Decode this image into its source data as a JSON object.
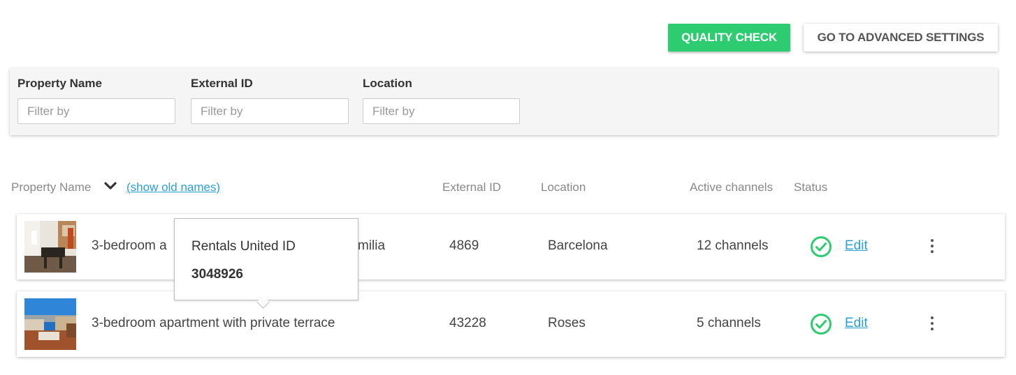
{
  "toolbar": {
    "quality_check_label": "QUALITY CHECK",
    "advanced_settings_label": "GO TO ADVANCED SETTINGS",
    "accent_color": "#2ecc71"
  },
  "filters": {
    "property_name": {
      "label": "Property Name",
      "placeholder": "Filter by",
      "value": ""
    },
    "external_id": {
      "label": "External ID",
      "placeholder": "Filter by",
      "value": ""
    },
    "location": {
      "label": "Location",
      "placeholder": "Filter by",
      "value": ""
    }
  },
  "table": {
    "headers": {
      "property_name": "Property Name",
      "show_old_names": "(show old names)",
      "external_id": "External ID",
      "location": "Location",
      "active_channels": "Active channels",
      "status": "Status"
    },
    "rows": [
      {
        "name": "3-bedroom apartment near Sagrada Familia",
        "name_visible_start": "3-bedroom a",
        "name_visible_end": "milia",
        "external_id": "4869",
        "location": "Barcelona",
        "channels": "12 channels",
        "status_icon": "check-circle-icon",
        "edit_label": "Edit"
      },
      {
        "name": "3-bedroom apartment with private terrace",
        "external_id": "43228",
        "location": "Roses",
        "channels": "5 channels",
        "status_icon": "check-circle-icon",
        "edit_label": "Edit"
      }
    ]
  },
  "tooltip": {
    "title": "Rentals United ID",
    "value": "3048926"
  },
  "colors": {
    "link": "#2a9fd6",
    "status_ok": "#2ecc71"
  }
}
